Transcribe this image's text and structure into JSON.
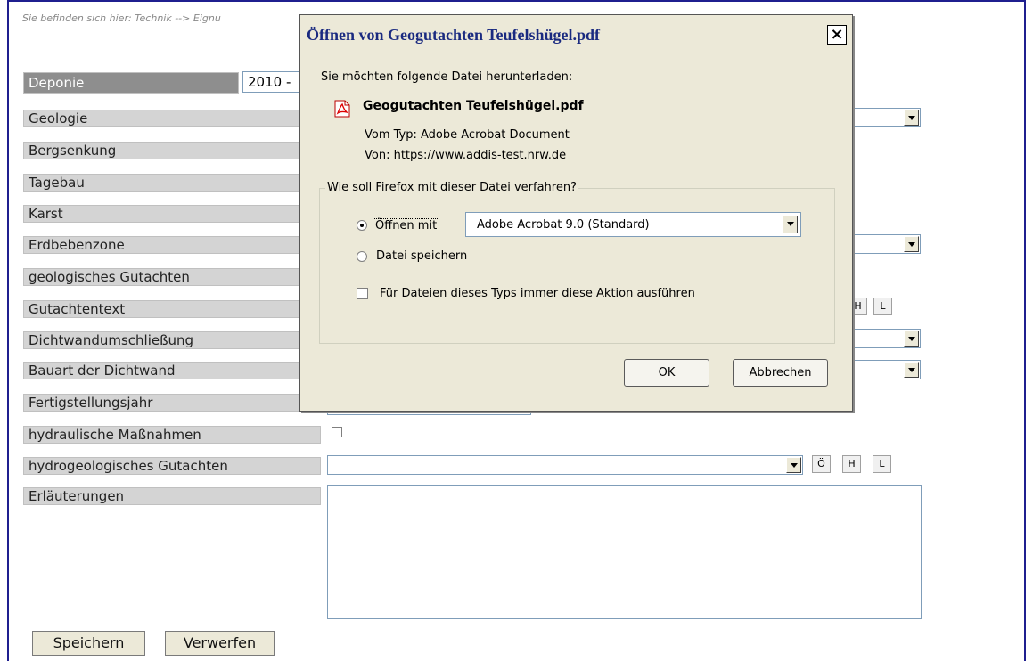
{
  "breadcrumb": "Sie befinden sich hier: Technik --> Eignu",
  "deponie": {
    "label": "Deponie",
    "year_value": "2010 -"
  },
  "form_labels": [
    "Geologie",
    "Bergsenkung",
    "Tagebau",
    "Karst",
    "Erdbebenzone",
    "geologisches Gutachten",
    "Gutachtentext",
    "Dichtwandumschließung",
    "Bauart der Dichtwand",
    "Fertigstellungsjahr",
    "hydraulische Maßnahmen",
    "hydrogeologisches Gutachten",
    "Erläuterungen"
  ],
  "small_buttons": {
    "o": "Ö",
    "h": "H",
    "l": "L"
  },
  "page_buttons": {
    "save": "Speichern",
    "discard": "Verwerfen"
  },
  "dialog": {
    "title": "Öffnen von Geogutachten Teufelshügel.pdf",
    "close_label": "×",
    "intro": "Sie möchten folgende Datei herunterladen:",
    "file_name": "Geogutachten Teufelshügel.pdf",
    "type_line": "Vom Typ:  Adobe Acrobat Document",
    "from_line": "Von:  https://www.addis-test.nrw.de",
    "group_title": "Wie soll Firefox mit dieser Datei verfahren?",
    "open_with_label": "Öffnen mit",
    "open_with_value": "Adobe Acrobat 9.0 (Standard)",
    "save_file_label": "Datei speichern",
    "always_label": "Für Dateien dieses Typs immer diese Aktion ausführen",
    "ok_label": "OK",
    "cancel_label": "Abbrechen"
  }
}
